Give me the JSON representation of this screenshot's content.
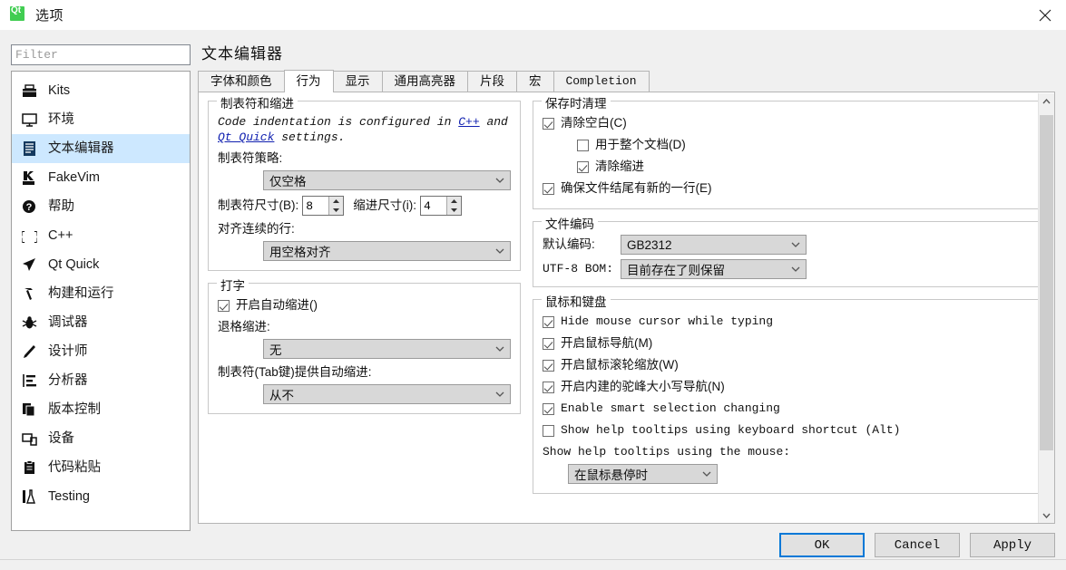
{
  "window": {
    "title": "选项",
    "logo_icon": "qt-logo-icon",
    "close_icon": "close-icon"
  },
  "sidebar": {
    "filter": {
      "value": "",
      "placeholder": "Filter"
    },
    "items": [
      {
        "label": "Kits",
        "icon": "kits-icon",
        "selected": false
      },
      {
        "label": "环境",
        "icon": "monitor-icon",
        "selected": false
      },
      {
        "label": "文本编辑器",
        "icon": "text-editor-icon",
        "selected": true
      },
      {
        "label": "FakeVim",
        "icon": "fakevim-icon",
        "selected": false
      },
      {
        "label": "帮助",
        "icon": "help-icon",
        "selected": false
      },
      {
        "label": "C++",
        "icon": "braces-icon",
        "selected": false
      },
      {
        "label": "Qt Quick",
        "icon": "qtquick-icon",
        "selected": false
      },
      {
        "label": "构建和运行",
        "icon": "hammer-icon",
        "selected": false
      },
      {
        "label": "调试器",
        "icon": "bug-icon",
        "selected": false
      },
      {
        "label": "设计师",
        "icon": "pencil-icon",
        "selected": false
      },
      {
        "label": "分析器",
        "icon": "analyzer-icon",
        "selected": false
      },
      {
        "label": "版本控制",
        "icon": "version-control-icon",
        "selected": false
      },
      {
        "label": "设备",
        "icon": "devices-icon",
        "selected": false
      },
      {
        "label": "代码粘贴",
        "icon": "clipboard-icon",
        "selected": false
      },
      {
        "label": "Testing",
        "icon": "flask-icon",
        "selected": false
      }
    ]
  },
  "page": {
    "title": "文本编辑器",
    "tabs": [
      {
        "label": "字体和颜色",
        "active": false,
        "mono": false
      },
      {
        "label": "行为",
        "active": true,
        "mono": false
      },
      {
        "label": "显示",
        "active": false,
        "mono": false
      },
      {
        "label": "通用高亮器",
        "active": false,
        "mono": false
      },
      {
        "label": "片段",
        "active": false,
        "mono": false
      },
      {
        "label": "宏",
        "active": false,
        "mono": false
      },
      {
        "label": "Completion",
        "active": false,
        "mono": true
      }
    ]
  },
  "tabs_indent": {
    "group_title": "制表符和缩进",
    "hint_before": "Code indentation is configured in ",
    "hint_link1": "C++",
    "hint_middle": " and ",
    "hint_link2": "Qt Quick",
    "hint_after": " settings.",
    "tab_policy_label": "制表符策略:",
    "tab_policy_value": "仅空格",
    "tab_size_label": "制表符尺寸(B):",
    "tab_size_value": "8",
    "indent_size_label": "缩进尺寸(i):",
    "indent_size_value": "4",
    "align_label": "对齐连续的行:",
    "align_value": "用空格对齐"
  },
  "typing": {
    "group_title": "打字",
    "auto_indent_label": "开启自动缩进()",
    "auto_indent_checked": true,
    "backspace_label": "退格缩进:",
    "backspace_value": "无",
    "tab_key_label": "制表符(Tab键)提供自动缩进:",
    "tab_key_value": "从不"
  },
  "cleanup": {
    "group_title": "保存时清理",
    "items": [
      {
        "label": "清除空白(C)",
        "checked": true,
        "indent": false
      },
      {
        "label": "用于整个文档(D)",
        "checked": false,
        "indent": true
      },
      {
        "label": "清除缩进",
        "checked": true,
        "indent": true
      },
      {
        "label": "确保文件结尾有新的一行(E)",
        "checked": true,
        "indent": false
      }
    ]
  },
  "encoding": {
    "group_title": "文件编码",
    "default_label": "默认编码:",
    "default_value": "GB2312",
    "bom_label": "UTF-8 BOM:",
    "bom_value": "目前存在了则保留"
  },
  "mouse_keyboard": {
    "group_title": "鼠标和键盘",
    "items": [
      {
        "label": "Hide mouse cursor while typing",
        "checked": true,
        "mono": true
      },
      {
        "label": "开启鼠标导航(M)",
        "checked": true,
        "mono": false
      },
      {
        "label": "开启鼠标滚轮缩放(W)",
        "checked": true,
        "mono": false
      },
      {
        "label": "开启内建的驼峰大小写导航(N)",
        "checked": true,
        "mono": false
      },
      {
        "label": "Enable smart selection changing",
        "checked": true,
        "mono": true
      },
      {
        "label": "Show help tooltips using keyboard shortcut (Alt)",
        "checked": false,
        "mono": true
      }
    ],
    "tooltip_mouse_label": "Show help tooltips using the mouse:",
    "tooltip_mouse_value": "在鼠标悬停时"
  },
  "buttons": {
    "ok": "OK",
    "cancel": "Cancel",
    "apply": "Apply"
  },
  "colors": {
    "accent": "#0078d7",
    "selection": "#cde8ff",
    "qt_green": "#41cd52"
  },
  "scrollbar": {
    "up_icon": "chevron-up-icon",
    "down_icon": "chevron-down-icon"
  }
}
